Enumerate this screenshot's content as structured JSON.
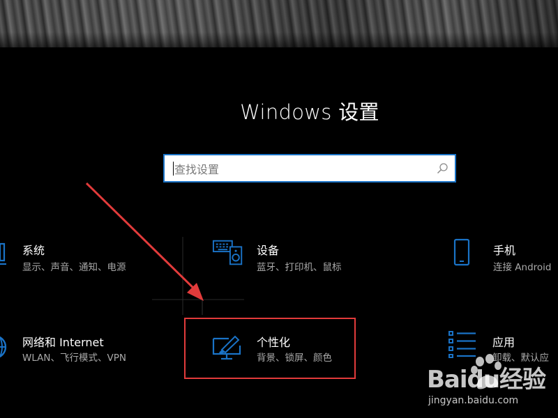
{
  "window": {
    "title": "Windows 设置"
  },
  "search": {
    "placeholder": "查找设置",
    "icon": "search-icon"
  },
  "tiles": [
    {
      "id": "system",
      "label": "系统",
      "desc": "显示、声音、通知、电源",
      "icon": "laptop-icon"
    },
    {
      "id": "devices",
      "label": "设备",
      "desc": "蓝牙、打印机、鼠标",
      "icon": "keyboard-speaker-icon"
    },
    {
      "id": "phone",
      "label": "手机",
      "desc": "连接 Android",
      "icon": "phone-icon"
    },
    {
      "id": "network",
      "label": "网络和 Internet",
      "desc": "WLAN、飞行模式、VPN",
      "icon": "globe-icon"
    },
    {
      "id": "personalization",
      "label": "个性化",
      "desc": "背景、锁屏、颜色",
      "icon": "brush-monitor-icon"
    },
    {
      "id": "apps",
      "label": "应用",
      "desc": "卸载、默认应",
      "icon": "app-list-icon"
    }
  ],
  "accent_color": "#1a73c7",
  "annotation": {
    "color": "#e23b3b",
    "highlighted_tile": "personalization"
  },
  "watermark": {
    "brand": "Baidu经验",
    "url": "jingyan.baidu.com"
  }
}
